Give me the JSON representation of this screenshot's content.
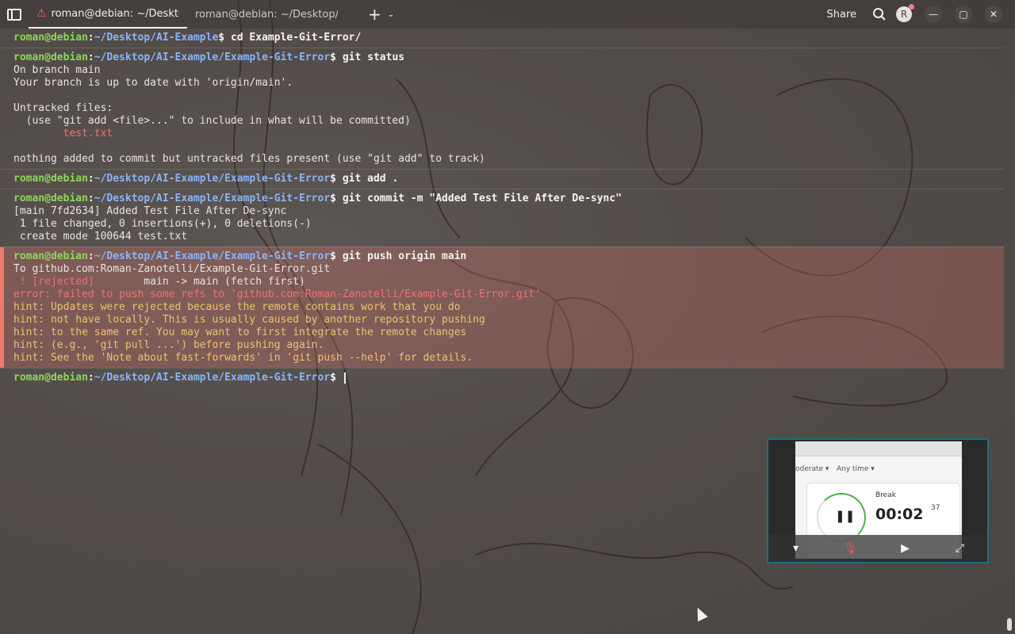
{
  "tabs": [
    {
      "title": "roman@debian: ~/Desktop/",
      "active": true,
      "warning": true
    },
    {
      "title": "roman@debian: ~/Desktop/Por",
      "active": false,
      "warning": false
    }
  ],
  "header": {
    "share": "Share",
    "avatar_initial": "R"
  },
  "icons": {
    "sidebar": "sidebar-icon",
    "new_tab": "plus-icon",
    "menu": "chevron-down-icon",
    "search": "search-icon",
    "minimize": "minimize-icon",
    "maximize": "maximize-icon",
    "close": "close-icon"
  },
  "colors": {
    "user": "#8ed65a",
    "path": "#8ab4f8",
    "error": "#f07070",
    "hint": "#f0c070",
    "error_band": "#f0796b"
  },
  "prompt": {
    "user": "roman@debian",
    "sep": ":"
  },
  "terminal": {
    "b1": {
      "path": "~/Desktop/AI-Example",
      "cmd": "cd Example-Git-Error/"
    },
    "b2": {
      "path": "~/Desktop/AI-Example/Example-Git-Error",
      "cmd": "git status",
      "out": [
        "On branch main",
        "Your branch is up to date with 'origin/main'.",
        "",
        "Untracked files:",
        "  (use \"git add <file>...\" to include in what will be committed)"
      ],
      "file": "        test.txt",
      "tail": [
        "",
        "nothing added to commit but untracked files present (use \"git add\" to track)"
      ]
    },
    "b3": {
      "path": "~/Desktop/AI-Example/Example-Git-Error",
      "cmd": "git add ."
    },
    "b4": {
      "path": "~/Desktop/AI-Example/Example-Git-Error",
      "cmd": "git commit -m \"Added Test File After De-sync\"",
      "out": [
        "[main 7fd2634] Added Test File After De-sync",
        " 1 file changed, 0 insertions(+), 0 deletions(-)",
        " create mode 100644 test.txt"
      ]
    },
    "b5": {
      "path": "~/Desktop/AI-Example/Example-Git-Error",
      "cmd": "git push origin main",
      "to": "To github.com:Roman-Zanotelli/Example-Git-Error.git",
      "rejected_a": " ! [rejected]",
      "rejected_b": "        main -> main (fetch first)",
      "error": "error: failed to push some refs to 'github.com:Roman-Zanotelli/Example-Git-Error.git'",
      "hints": [
        "hint: Updates were rejected because the remote contains work that you do",
        "hint: not have locally. This is usually caused by another repository pushing",
        "hint: to the same ref. You may want to first integrate the remote changes",
        "hint: (e.g., 'git pull ...') before pushing again.",
        "hint: See the 'Note about fast-forwards' in 'git push --help' for details."
      ]
    },
    "b6": {
      "path": "~/Desktop/AI-Example/Example-Git-Error"
    }
  },
  "pip": {
    "filter1": "oderate ▾",
    "filter2": "Any time ▾",
    "label": "Break",
    "time": "00:02",
    "seconds": "37",
    "progress": 0.3
  }
}
